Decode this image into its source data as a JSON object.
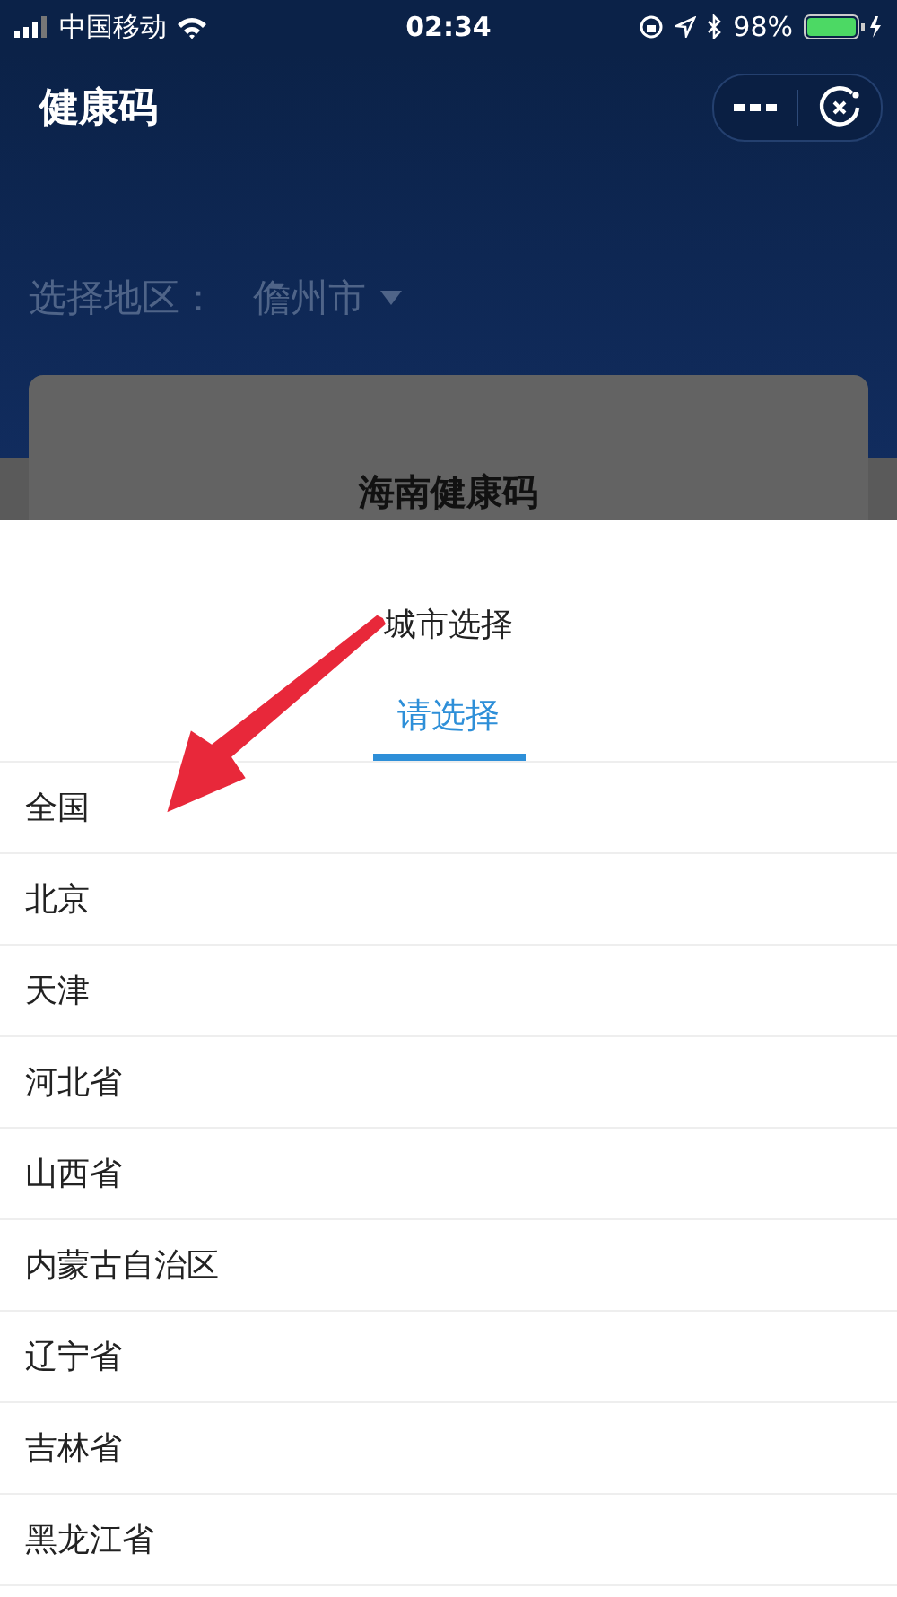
{
  "status_bar": {
    "carrier": "中国移动",
    "time": "02:34",
    "battery": "98%"
  },
  "header": {
    "title": "健康码"
  },
  "region": {
    "label": "选择地区：",
    "value": "儋州市"
  },
  "card": {
    "title": "海南健康码"
  },
  "sheet": {
    "title": "城市选择",
    "tabs": [
      {
        "label": "请选择",
        "selected": true
      }
    ],
    "items": [
      "全国",
      "北京",
      "天津",
      "河北省",
      "山西省",
      "内蒙古自治区",
      "辽宁省",
      "吉林省",
      "黑龙江省"
    ]
  }
}
